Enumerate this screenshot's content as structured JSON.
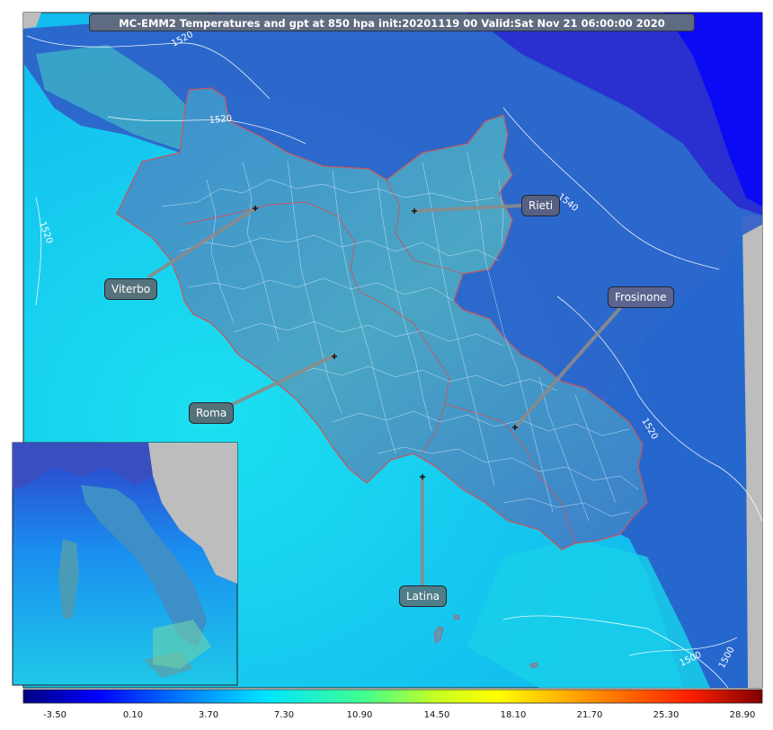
{
  "title": "MC-EMM2 Temperatures and gpt at 850 hpa init:20201119 00  Valid:Sat Nov 21 06:00:00 2020",
  "cities": [
    {
      "name": "Viterbo",
      "color": "#56737c"
    },
    {
      "name": "Rieti",
      "color": "#575f83"
    },
    {
      "name": "Frosinone",
      "color": "#5c6590"
    },
    {
      "name": "Roma",
      "color": "#55717a"
    },
    {
      "name": "Latina",
      "color": "#4f7d88"
    }
  ],
  "contour_labels": [
    "1520",
    "1520",
    "1520",
    "1540",
    "1520",
    "1500",
    "1500"
  ],
  "colorbar": {
    "ticks": [
      "-3.50",
      "0.10",
      "3.70",
      "7.30",
      "10.90",
      "14.50",
      "18.10",
      "21.70",
      "25.30",
      "28.90"
    ],
    "colors": [
      "#000080",
      "#0000ff",
      "#0080ff",
      "#00e5ff",
      "#40ff90",
      "#c8ff20",
      "#ffff00",
      "#ff9800",
      "#ff2000",
      "#800000"
    ]
  },
  "colors": {
    "sea": "#12c9f0",
    "land": "#4aa3c4",
    "cold": "#2a32c8",
    "region_border": "#c8555a"
  }
}
